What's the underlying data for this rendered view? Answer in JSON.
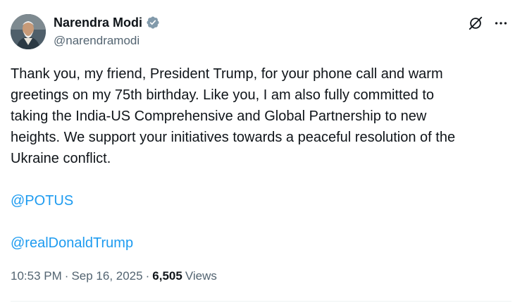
{
  "author": {
    "display_name": "Narendra Modi",
    "handle": "@narendramodi",
    "verified": true,
    "verified_color": "#829aab"
  },
  "actions": {
    "grok_icon": "grok-icon",
    "more_icon": "more-icon"
  },
  "tweet": {
    "text_lines": [
      "Thank you, my friend, President Trump, for your phone call and warm",
      "greetings on my 75th birthday. Like you, I am also fully committed to",
      "taking the India-US Comprehensive and Global Partnership to new",
      "heights. We support your initiatives towards a peaceful resolution of the",
      "Ukraine conflict."
    ],
    "mentions": [
      "@POTUS",
      "@realDonaldTrump"
    ]
  },
  "meta": {
    "time": "10:53 PM",
    "separator": "·",
    "date": "Sep 16, 2025",
    "views_count": "6,505",
    "views_label": "Views"
  },
  "colors": {
    "text": "#0f1419",
    "secondary": "#536471",
    "link": "#1d9bf0"
  }
}
